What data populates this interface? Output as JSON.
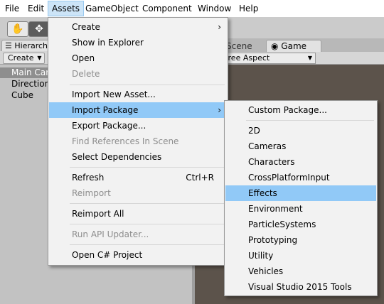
{
  "menubar": {
    "items": [
      {
        "label": "File"
      },
      {
        "label": "Edit"
      },
      {
        "label": "Assets"
      },
      {
        "label": "GameObject"
      },
      {
        "label": "Component"
      },
      {
        "label": "Window"
      },
      {
        "label": "Help"
      }
    ],
    "active": "Assets"
  },
  "toolbar": {
    "hand_tool_icon": "hand-icon",
    "move_tool_icon": "move-icon"
  },
  "hierarchy": {
    "tab_label": "Hierarchy",
    "create_label": "Create",
    "items": [
      "Main Camera",
      "Directional Light",
      "Cube"
    ],
    "selected": "Main Camera"
  },
  "scene_tab": {
    "label": "Scene"
  },
  "game": {
    "tab_label": "Game",
    "aspect_label": "Free Aspect",
    "viewport_color": "#5c534b"
  },
  "assets_menu": {
    "items": [
      {
        "label": "Create",
        "submenu": true
      },
      {
        "label": "Show in Explorer"
      },
      {
        "label": "Open"
      },
      {
        "label": "Delete",
        "disabled": true
      },
      {
        "label": "Import New Asset..."
      },
      {
        "label": "Import Package",
        "submenu": true,
        "highlighted": true
      },
      {
        "label": "Export Package..."
      },
      {
        "label": "Find References In Scene",
        "disabled": true
      },
      {
        "label": "Select Dependencies"
      },
      {
        "label": "Refresh",
        "shortcut": "Ctrl+R"
      },
      {
        "label": "Reimport",
        "disabled": true
      },
      {
        "label": "Reimport All"
      },
      {
        "label": "Run API Updater...",
        "disabled": true
      },
      {
        "label": "Open C# Project"
      }
    ]
  },
  "import_package_menu": {
    "items": [
      {
        "label": "Custom Package..."
      },
      {
        "label": "2D"
      },
      {
        "label": "Cameras"
      },
      {
        "label": "Characters"
      },
      {
        "label": "CrossPlatformInput"
      },
      {
        "label": "Effects",
        "highlighted": true
      },
      {
        "label": "Environment"
      },
      {
        "label": "ParticleSystems"
      },
      {
        "label": "Prototyping"
      },
      {
        "label": "Utility"
      },
      {
        "label": "Vehicles"
      },
      {
        "label": "Visual Studio 2015 Tools"
      }
    ]
  },
  "colors": {
    "highlight": "#91c9f7",
    "menu_bg": "#f2f2f2",
    "disabled_text": "#8d8d8d"
  }
}
